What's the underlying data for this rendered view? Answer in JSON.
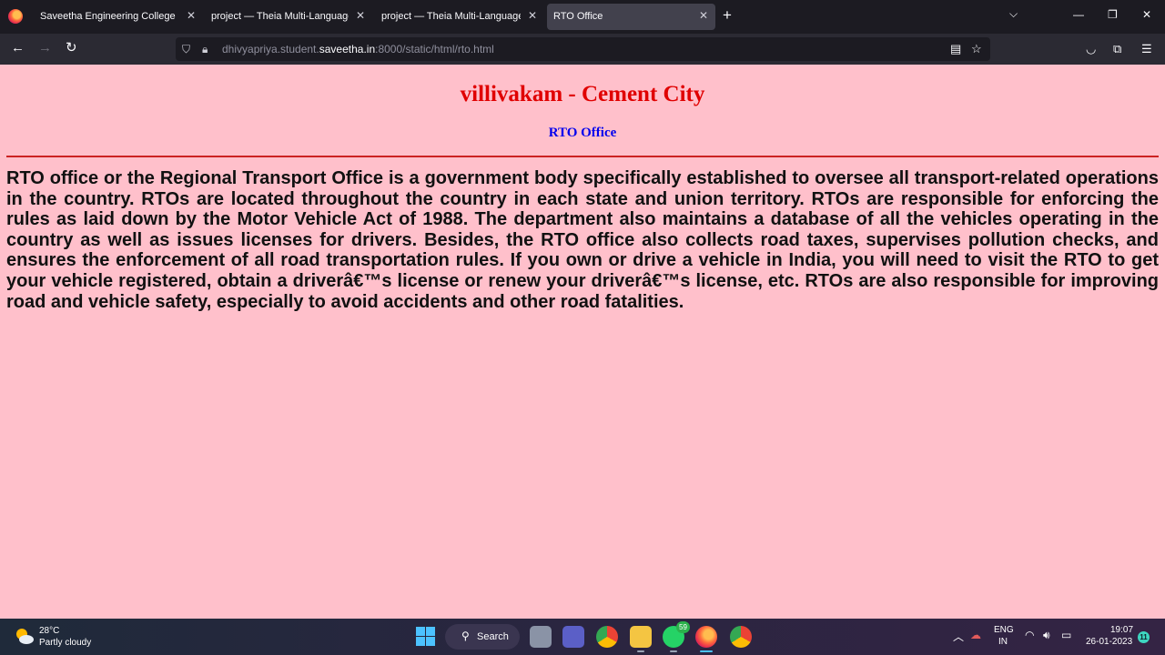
{
  "browser": {
    "tabs": [
      {
        "label": "Saveetha Engineering College",
        "active": false
      },
      {
        "label": "project — Theia Multi-Language Ex",
        "active": false
      },
      {
        "label": "project — Theia Multi-Language Ex",
        "active": false
      },
      {
        "label": "RTO Office",
        "active": true
      }
    ],
    "url": {
      "prefix": "dhivyapriya.student.",
      "host": "saveetha.in",
      "suffix": ":8000/static/html/rto.html"
    }
  },
  "page": {
    "heading": "villivakam - Cement City",
    "subheading": "RTO Office",
    "paragraph": "RTO office or the Regional Transport Office is a government body specifically established to oversee all transport-related operations in the country. RTOs are located throughout the country in each state and union territory. RTOs are responsible for enforcing the rules as laid down by the Motor Vehicle Act of 1988. The department also maintains a database of all the vehicles operating in the country as well as issues licenses for drivers. Besides, the RTO office also collects road taxes, supervises pollution checks, and ensures the enforcement of all road transportation rules. If you own or drive a vehicle in India, you will need to visit the RTO to get your vehicle registered, obtain a driverâ€™s license or renew your driverâ€™s license, etc. RTOs are also responsible for improving road and vehicle safety, especially to avoid accidents and other road fatalities."
  },
  "taskbar": {
    "weather": {
      "temp": "28°C",
      "desc": "Partly cloudy"
    },
    "search_label": "Search",
    "whatsapp_badge": "59",
    "lang_line1": "ENG",
    "lang_line2": "IN",
    "time": "19:07",
    "date": "26-01-2023",
    "notification_count": "11"
  },
  "colors": {
    "page_bg": "#ffc0cb",
    "heading": "#e00000",
    "subheading": "#0000ee",
    "rule": "#cc2222"
  }
}
